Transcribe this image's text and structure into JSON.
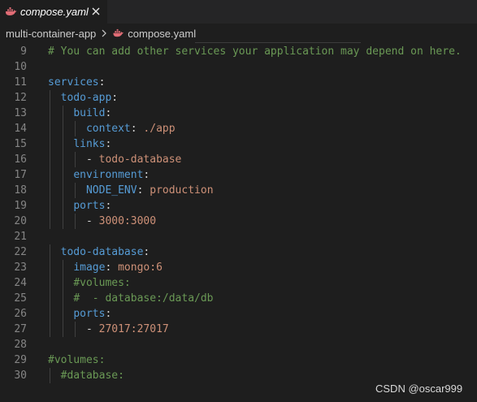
{
  "tab": {
    "filename": "compose.yaml",
    "close_glyph": "✕",
    "icon": "docker-whale-icon",
    "icon_color": "#e06c75"
  },
  "breadcrumb": {
    "folder": "multi-container-app",
    "file": "compose.yaml"
  },
  "editor": {
    "colors": {
      "comment": "#6a9955",
      "key": "#569cd6",
      "value": "#ce9178",
      "line_number": "#858585"
    },
    "lines": [
      {
        "num": "9",
        "indent": "",
        "key": "",
        "sep": "",
        "value": "",
        "comment": "# You can add other services your application may depend on here."
      },
      {
        "num": "10",
        "indent": "",
        "key": "",
        "sep": "",
        "value": "",
        "comment": ""
      },
      {
        "num": "11",
        "indent": "",
        "key": "services",
        "sep": ":",
        "value": "",
        "comment": ""
      },
      {
        "num": "12",
        "indent": "  ",
        "key": "todo-app",
        "sep": ":",
        "value": "",
        "comment": ""
      },
      {
        "num": "13",
        "indent": "    ",
        "key": "build",
        "sep": ":",
        "value": "",
        "comment": ""
      },
      {
        "num": "14",
        "indent": "      ",
        "key": "context",
        "sep": ": ",
        "value": "./app",
        "comment": ""
      },
      {
        "num": "15",
        "indent": "    ",
        "key": "links",
        "sep": ":",
        "value": "",
        "comment": ""
      },
      {
        "num": "16",
        "indent": "      ",
        "key": "",
        "sep": "- ",
        "value": "todo-database",
        "comment": ""
      },
      {
        "num": "17",
        "indent": "    ",
        "key": "environment",
        "sep": ":",
        "value": "",
        "comment": ""
      },
      {
        "num": "18",
        "indent": "      ",
        "key": "NODE_ENV",
        "sep": ": ",
        "value": "production",
        "comment": ""
      },
      {
        "num": "19",
        "indent": "    ",
        "key": "ports",
        "sep": ":",
        "value": "",
        "comment": ""
      },
      {
        "num": "20",
        "indent": "      ",
        "key": "",
        "sep": "- ",
        "value": "3000:3000",
        "comment": ""
      },
      {
        "num": "21",
        "indent": "",
        "key": "",
        "sep": "",
        "value": "",
        "comment": ""
      },
      {
        "num": "22",
        "indent": "  ",
        "key": "todo-database",
        "sep": ":",
        "value": "",
        "comment": ""
      },
      {
        "num": "23",
        "indent": "    ",
        "key": "image",
        "sep": ": ",
        "value": "mongo:6",
        "comment": ""
      },
      {
        "num": "24",
        "indent": "    ",
        "key": "",
        "sep": "",
        "value": "",
        "comment": "#volumes:"
      },
      {
        "num": "25",
        "indent": "    ",
        "key": "",
        "sep": "",
        "value": "",
        "comment": "#  - database:/data/db"
      },
      {
        "num": "26",
        "indent": "    ",
        "key": "ports",
        "sep": ":",
        "value": "",
        "comment": ""
      },
      {
        "num": "27",
        "indent": "      ",
        "key": "",
        "sep": "- ",
        "value": "27017:27017",
        "comment": ""
      },
      {
        "num": "28",
        "indent": "",
        "key": "",
        "sep": "",
        "value": "",
        "comment": ""
      },
      {
        "num": "29",
        "indent": "",
        "key": "",
        "sep": "",
        "value": "",
        "comment": "#volumes:"
      },
      {
        "num": "30",
        "indent": "  ",
        "key": "",
        "sep": "",
        "value": "",
        "comment": "#database:"
      }
    ]
  },
  "watermark": "CSDN @oscar999"
}
